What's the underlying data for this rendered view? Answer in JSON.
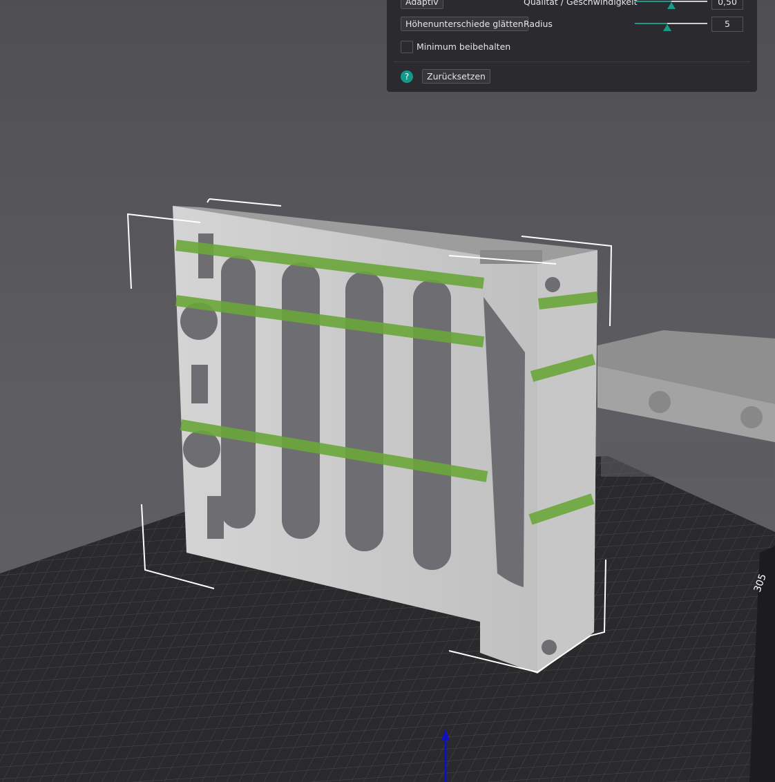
{
  "panel": {
    "adaptive_label": "Adaptiv",
    "quality_label": "Qualität / Geschwindigkeit",
    "quality_value": "0,50",
    "quality_slider_fraction": 0.5,
    "smooth_label": "Höhenunterschiede glätten",
    "radius_label": "Radius",
    "radius_value": "5",
    "radius_slider_fraction": 0.45,
    "keep_min_label": "Minimum beibehalten",
    "keep_min_checked": false,
    "help_icon": "?",
    "reset_label": "Zurücksetzen",
    "accent_color": "#109a8c"
  },
  "scene": {
    "bed_size_label": "305",
    "layer_highlight_color": "#6aa63a",
    "bed_color": "#2a2a2d"
  }
}
